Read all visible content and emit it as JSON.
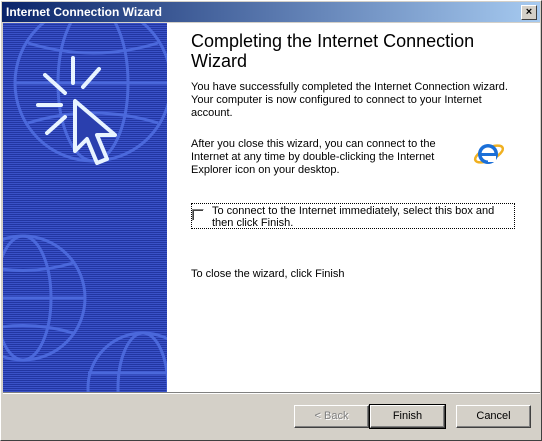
{
  "window": {
    "title": "Internet Connection Wizard",
    "close_label": "×"
  },
  "main": {
    "heading": "Completing the Internet Connection Wizard",
    "para1": "You have successfully completed the Internet Connection wizard. Your computer is now configured to connect to your Internet account.",
    "para2": "After you close this wizard, you can connect to the Internet at any time by double-clicking the Internet Explorer icon on your desktop.",
    "checkbox_label": "To connect to the Internet immediately, select this box and then click Finish.",
    "checkbox_checked": false,
    "para3": "To close the wizard, click Finish"
  },
  "buttons": {
    "back": "< Back",
    "finish": "Finish",
    "cancel": "Cancel"
  },
  "colors": {
    "sidebar": "#2a3fae",
    "titlebar_start": "#0a246a",
    "titlebar_end": "#a6caf0"
  }
}
